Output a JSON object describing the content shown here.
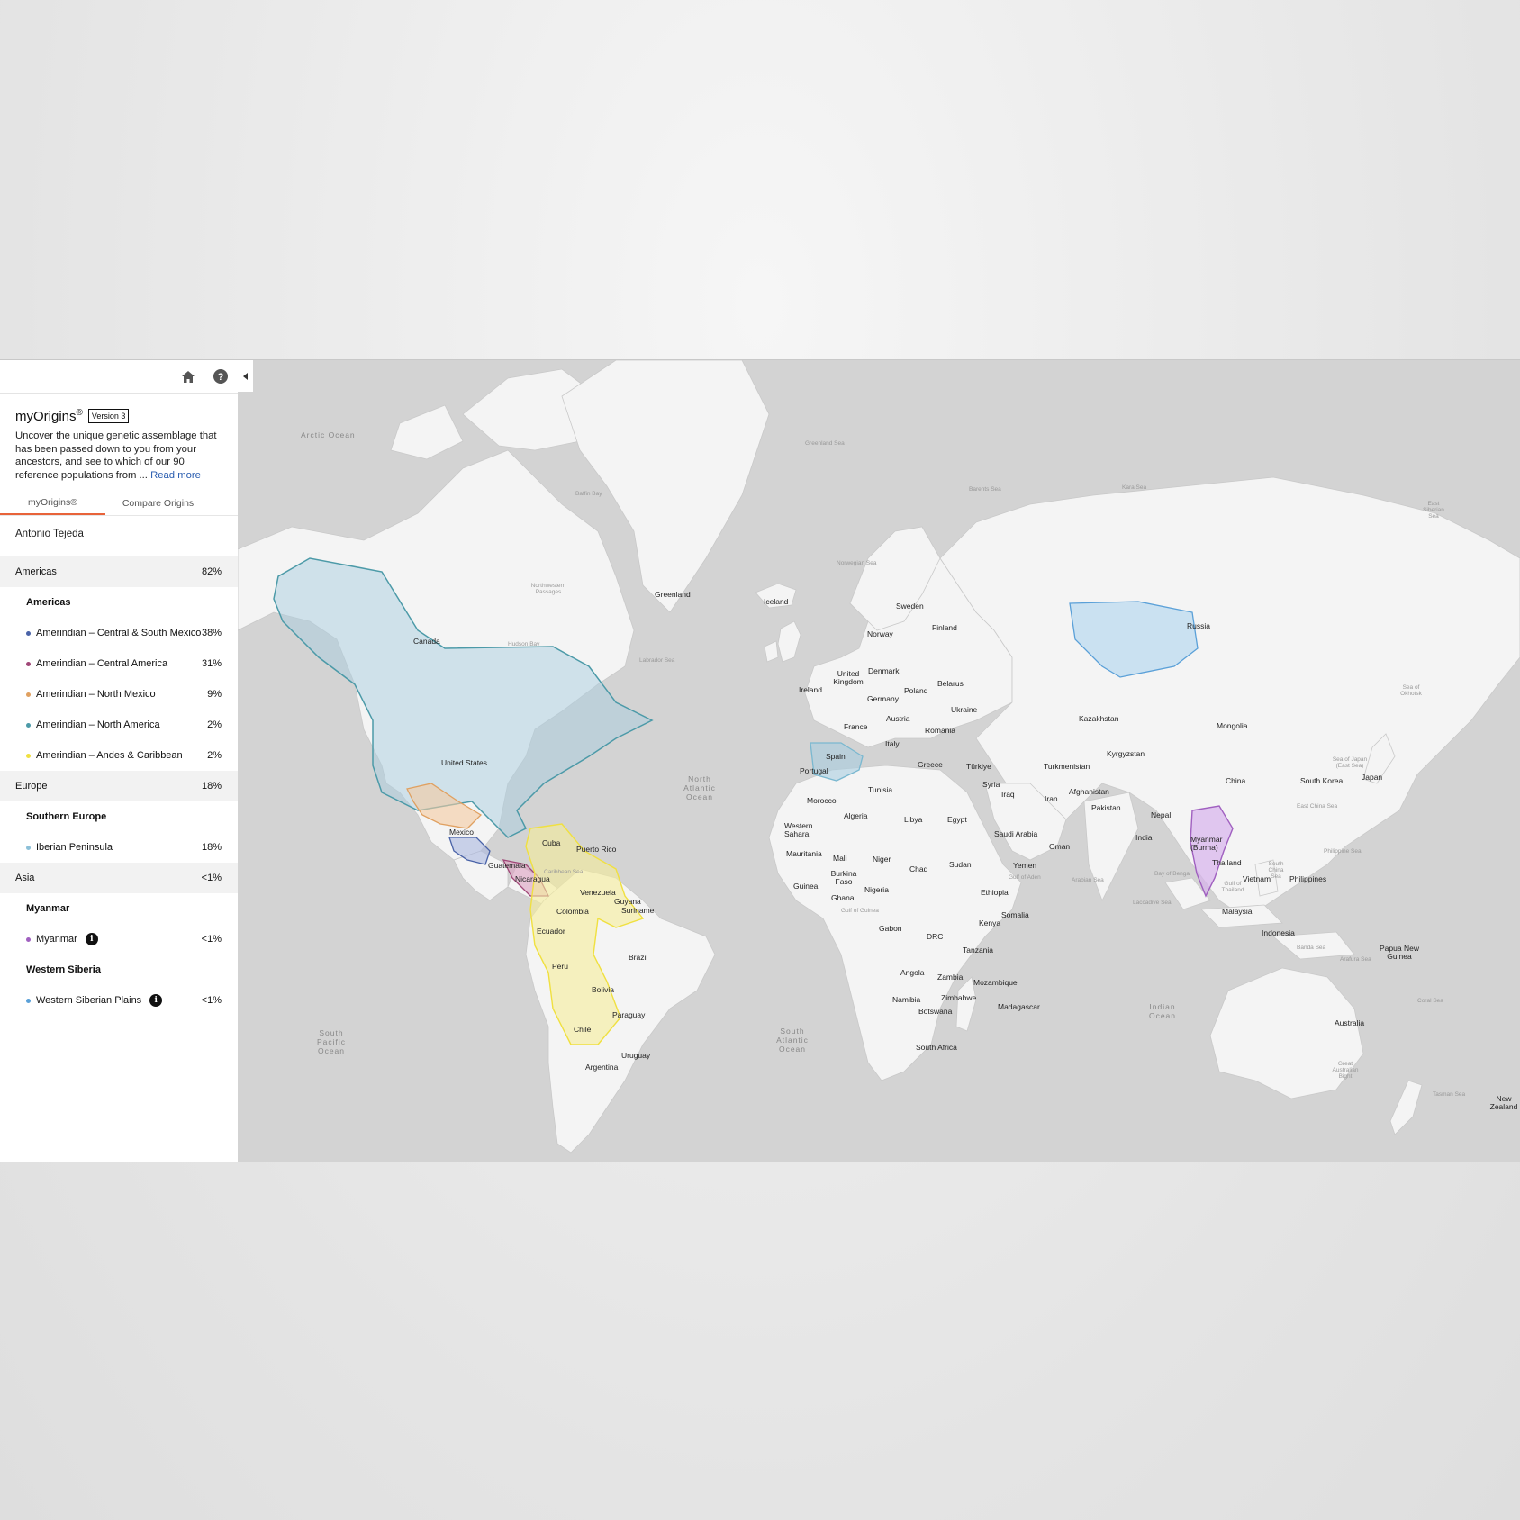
{
  "topbar": {
    "home_icon": "home-icon",
    "help_icon": "help-icon"
  },
  "intro": {
    "title": "myOrigins",
    "title_mark": "®",
    "version_badge": "Version 3",
    "description": "Uncover the unique genetic assemblage that has been passed down to you from your ancestors, and see to which of our 90 reference populations from ...",
    "read_more": "Read more"
  },
  "tabs": [
    {
      "label": "myOrigins®",
      "active": true
    },
    {
      "label": "Compare Origins",
      "active": false
    }
  ],
  "person_name": "Antonio Tejeda",
  "groups": [
    {
      "name": "Americas",
      "pct": "82%",
      "subgroups": [
        {
          "name": "Americas",
          "items": [
            {
              "name": "Amerindian – Central & South Mexico",
              "pct": "38%",
              "color": "#4a63a8"
            },
            {
              "name": "Amerindian – Central America",
              "pct": "31%",
              "color": "#a04777"
            },
            {
              "name": "Amerindian – North Mexico",
              "pct": "9%",
              "color": "#e0a060"
            },
            {
              "name": "Amerindian – North America",
              "pct": "2%",
              "color": "#4c9aa8"
            },
            {
              "name": "Amerindian – Andes & Caribbean",
              "pct": "2%",
              "color": "#f0e040"
            }
          ]
        }
      ]
    },
    {
      "name": "Europe",
      "pct": "18%",
      "subgroups": [
        {
          "name": "Southern Europe",
          "items": [
            {
              "name": "Iberian Peninsula",
              "pct": "18%",
              "color": "#8cc0d8"
            }
          ]
        }
      ]
    },
    {
      "name": "Asia",
      "pct": "<1%",
      "subgroups": [
        {
          "name": "Myanmar",
          "items": [
            {
              "name": "Myanmar",
              "pct": "<1%",
              "color": "#a060c0",
              "info": "i"
            }
          ]
        },
        {
          "name": "Western Siberia",
          "items": [
            {
              "name": "Western Siberian Plains",
              "pct": "<1%",
              "color": "#5aa0d8",
              "info": "i"
            }
          ]
        }
      ]
    }
  ],
  "map": {
    "countries": [
      "Greenland",
      "Iceland",
      "Canada",
      "United States",
      "Mexico",
      "Cuba",
      "Puerto Rico",
      "Guatemala",
      "Nicaragua",
      "Venezuela",
      "Guyana",
      "Suriname",
      "Colombia",
      "Ecuador",
      "Peru",
      "Brazil",
      "Bolivia",
      "Paraguay",
      "Chile",
      "Uruguay",
      "Argentina",
      "Sweden",
      "Norway",
      "Finland",
      "Denmark",
      "United Kingdom",
      "Ireland",
      "Poland",
      "Belarus",
      "Germany",
      "Ukraine",
      "Austria",
      "France",
      "Romania",
      "Italy",
      "Spain",
      "Portugal",
      "Greece",
      "Türkiye",
      "Russia",
      "Kazakhstan",
      "Mongolia",
      "Kyrgyzstan",
      "Turkmenistan",
      "China",
      "South Korea",
      "Japan",
      "Syria",
      "Iraq",
      "Iran",
      "Afghanistan",
      "Pakistan",
      "Nepal",
      "India",
      "Myanmar (Burma)",
      "Thailand",
      "Vietnam",
      "Philippines",
      "Malaysia",
      "Indonesia",
      "Papua New Guinea",
      "Australia",
      "New Zealand",
      "Morocco",
      "Tunisia",
      "Algeria",
      "Libya",
      "Egypt",
      "Western Sahara",
      "Mauritania",
      "Mali",
      "Niger",
      "Chad",
      "Sudan",
      "Saudi Arabia",
      "Oman",
      "Yemen",
      "Burkina Faso",
      "Guinea",
      "Ghana",
      "Nigeria",
      "Ethiopia",
      "Somalia",
      "Gabon",
      "DRC",
      "Kenya",
      "Tanzania",
      "Angola",
      "Zambia",
      "Mozambique",
      "Namibia",
      "Zimbabwe",
      "Botswana",
      "Madagascar",
      "South Africa"
    ],
    "oceans": [
      "Arctic Ocean",
      "North Atlantic Ocean",
      "South Atlantic Ocean",
      "South Pacific Ocean",
      "Indian Ocean"
    ],
    "seas": [
      "Greenland Sea",
      "Baffin Bay",
      "Barents Sea",
      "Kara Sea",
      "East Siberian Sea",
      "Norwegian Sea",
      "Northwestern Passages",
      "Hudson Bay",
      "Labrador Sea",
      "Sea of Okhotsk",
      "Sea of Japan (East Sea)",
      "East China Sea",
      "Philippine Sea",
      "South China Sea",
      "Bay of Bengal",
      "Arabian Sea",
      "Gulf of Aden",
      "Gulf of Guinea",
      "Laccadive Sea",
      "Banda Sea",
      "Arafura Sea",
      "Coral Sea",
      "Great Australian Bight",
      "Tasman Sea",
      "Caribbean Sea",
      "Gulf of Thailand"
    ]
  }
}
